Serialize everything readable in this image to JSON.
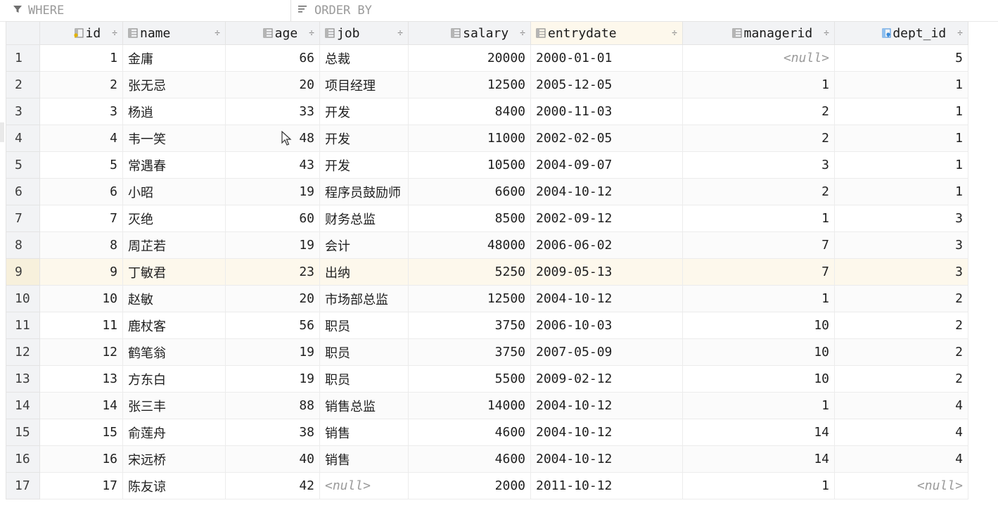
{
  "filter": {
    "where_label": "WHERE",
    "order_label": "ORDER BY"
  },
  "columns": [
    {
      "key": "id",
      "label": "id",
      "icon": "primary-key-column-icon"
    },
    {
      "key": "name",
      "label": "name",
      "icon": "column-icon"
    },
    {
      "key": "age",
      "label": "age",
      "icon": "column-icon"
    },
    {
      "key": "job",
      "label": "job",
      "icon": "column-icon"
    },
    {
      "key": "salary",
      "label": "salary",
      "icon": "column-icon"
    },
    {
      "key": "entrydate",
      "label": "entrydate",
      "icon": "column-icon"
    },
    {
      "key": "managerid",
      "label": "managerid",
      "icon": "column-icon"
    },
    {
      "key": "dept_id",
      "label": "dept_id",
      "icon": "foreign-key-column-icon"
    }
  ],
  "sort_glyph": "÷",
  "null_text": "<null>",
  "rows": [
    {
      "n": "1",
      "id": "1",
      "name": "金庸",
      "age": "66",
      "job": "总裁",
      "salary": "20000",
      "entrydate": "2000-01-01",
      "managerid": null,
      "dept_id": "5"
    },
    {
      "n": "2",
      "id": "2",
      "name": "张无忌",
      "age": "20",
      "job": "项目经理",
      "salary": "12500",
      "entrydate": "2005-12-05",
      "managerid": "1",
      "dept_id": "1"
    },
    {
      "n": "3",
      "id": "3",
      "name": "杨逍",
      "age": "33",
      "job": "开发",
      "salary": "8400",
      "entrydate": "2000-11-03",
      "managerid": "2",
      "dept_id": "1"
    },
    {
      "n": "4",
      "id": "4",
      "name": "韦一笑",
      "age": "48",
      "job": "开发",
      "salary": "11000",
      "entrydate": "2002-02-05",
      "managerid": "2",
      "dept_id": "1"
    },
    {
      "n": "5",
      "id": "5",
      "name": "常遇春",
      "age": "43",
      "job": "开发",
      "salary": "10500",
      "entrydate": "2004-09-07",
      "managerid": "3",
      "dept_id": "1"
    },
    {
      "n": "6",
      "id": "6",
      "name": "小昭",
      "age": "19",
      "job": "程序员鼓励师",
      "salary": "6600",
      "entrydate": "2004-10-12",
      "managerid": "2",
      "dept_id": "1"
    },
    {
      "n": "7",
      "id": "7",
      "name": "灭绝",
      "age": "60",
      "job": "财务总监",
      "salary": "8500",
      "entrydate": "2002-09-12",
      "managerid": "1",
      "dept_id": "3"
    },
    {
      "n": "8",
      "id": "8",
      "name": "周芷若",
      "age": "19",
      "job": "会计",
      "salary": "48000",
      "entrydate": "2006-06-02",
      "managerid": "7",
      "dept_id": "3"
    },
    {
      "n": "9",
      "id": "9",
      "name": "丁敏君",
      "age": "23",
      "job": "出纳",
      "salary": "5250",
      "entrydate": "2009-05-13",
      "managerid": "7",
      "dept_id": "3"
    },
    {
      "n": "10",
      "id": "10",
      "name": "赵敏",
      "age": "20",
      "job": "市场部总监",
      "salary": "12500",
      "entrydate": "2004-10-12",
      "managerid": "1",
      "dept_id": "2"
    },
    {
      "n": "11",
      "id": "11",
      "name": "鹿杖客",
      "age": "56",
      "job": "职员",
      "salary": "3750",
      "entrydate": "2006-10-03",
      "managerid": "10",
      "dept_id": "2"
    },
    {
      "n": "12",
      "id": "12",
      "name": "鹤笔翁",
      "age": "19",
      "job": "职员",
      "salary": "3750",
      "entrydate": "2007-05-09",
      "managerid": "10",
      "dept_id": "2"
    },
    {
      "n": "13",
      "id": "13",
      "name": "方东白",
      "age": "19",
      "job": "职员",
      "salary": "5500",
      "entrydate": "2009-02-12",
      "managerid": "10",
      "dept_id": "2"
    },
    {
      "n": "14",
      "id": "14",
      "name": "张三丰",
      "age": "88",
      "job": "销售总监",
      "salary": "14000",
      "entrydate": "2004-10-12",
      "managerid": "1",
      "dept_id": "4"
    },
    {
      "n": "15",
      "id": "15",
      "name": "俞莲舟",
      "age": "38",
      "job": "销售",
      "salary": "4600",
      "entrydate": "2004-10-12",
      "managerid": "14",
      "dept_id": "4"
    },
    {
      "n": "16",
      "id": "16",
      "name": "宋远桥",
      "age": "40",
      "job": "销售",
      "salary": "4600",
      "entrydate": "2004-10-12",
      "managerid": "14",
      "dept_id": "4"
    },
    {
      "n": "17",
      "id": "17",
      "name": "陈友谅",
      "age": "42",
      "job": null,
      "salary": "2000",
      "entrydate": "2011-10-12",
      "managerid": "1",
      "dept_id": null
    }
  ],
  "selected_row": "9",
  "selected_column": "entrydate",
  "colors": {
    "selection_cell": "#a8d1fb",
    "selected_row": "#fdf8ec",
    "header_bg": "#f2f3f5",
    "null_text": "#9a9a9a"
  }
}
